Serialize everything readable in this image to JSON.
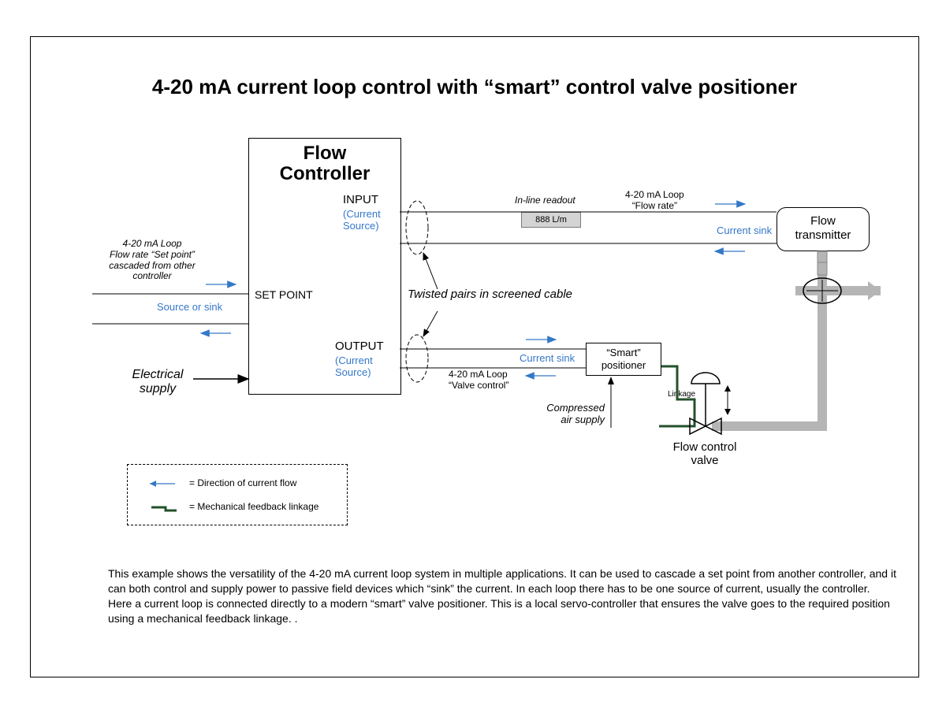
{
  "title": "4-20 mA current loop control with “smart” control valve positioner",
  "controller": {
    "title1": "Flow",
    "title2": "Controller",
    "input_lbl": "INPUT",
    "input_sub": "(Current Source)",
    "output_lbl": "OUTPUT",
    "output_sub": "(Current Source)",
    "setpoint_lbl": "SET POINT"
  },
  "setpoint_note": {
    "l1": "4-20 mA Loop",
    "l2": "Flow rate “Set point”",
    "l3": "cascaded from other",
    "l4": "controller"
  },
  "source_or_sink": "Source or sink",
  "electrical_supply": "Electrical supply",
  "twisted_pairs": "Twisted pairs in screened cable",
  "readout_lbl": "In-line readout",
  "readout_val": "888 L/m",
  "loop_flowrate": {
    "l1": "4-20 mA Loop",
    "l2": "“Flow rate”"
  },
  "loop_valvecontrol": {
    "l1": "4-20 mA Loop",
    "l2": "“Valve control”"
  },
  "current_sink1": "Current sink",
  "current_sink2": "Current sink",
  "transmitter": {
    "l1": "Flow",
    "l2": "transmitter"
  },
  "positioner": {
    "l1": "“Smart”",
    "l2": "positioner"
  },
  "compressed_air": "Compressed air supply",
  "linkage": "Linkage",
  "valve_label": "Flow control valve",
  "legend": {
    "arrow": "= Direction of current flow",
    "link": "= Mechanical feedback linkage"
  },
  "description": "This example shows the versatility of the 4-20 mA current loop system in multiple applications. It can be used to cascade a set point from another controller, and it can both control and supply power to passive field devices which “sink” the current. In each loop there has to be one source of current, usually the controller.\nHere a current loop is connected directly to a modern “smart” valve positioner. This is a local servo-controller that ensures the valve goes to the required position using a mechanical feedback linkage. ."
}
